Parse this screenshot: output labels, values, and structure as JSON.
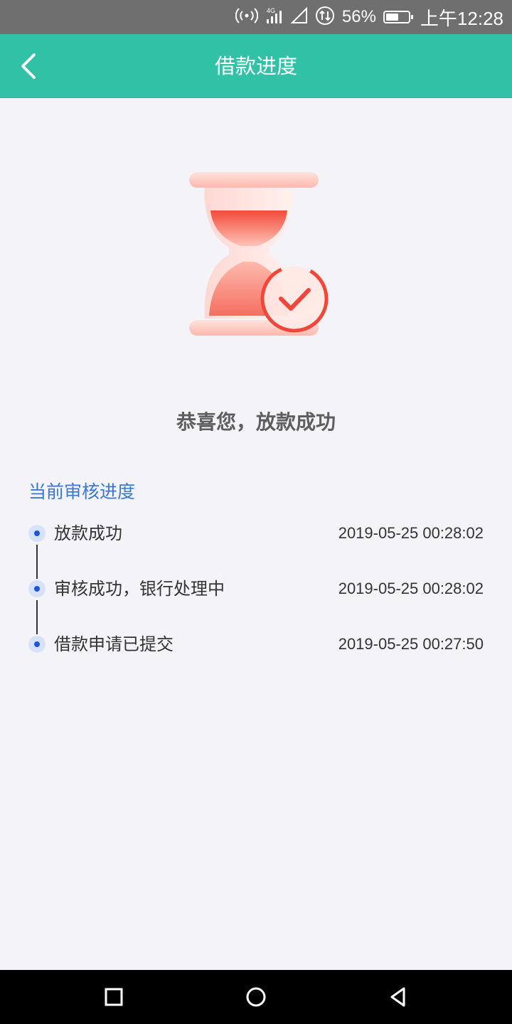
{
  "status_bar": {
    "battery_percent": "56%",
    "battery_level": 0.56,
    "clock": "上午12:28",
    "icons": [
      "hotspot-icon",
      "signal-4g-icon",
      "signal-empty-icon",
      "data-icon",
      "battery-icon"
    ]
  },
  "header": {
    "title": "借款进度",
    "back_icon": "chevron-left-icon",
    "background": "#30c1a6"
  },
  "hero": {
    "icon": "hourglass-check-illustration",
    "message": "恭喜您，放款成功"
  },
  "progress": {
    "heading": "当前审核进度",
    "heading_color": "#3c78d2",
    "steps": [
      {
        "label": "放款成功",
        "time": "2019-05-25 00:28:02"
      },
      {
        "label": "审核成功，银行处理中",
        "time": "2019-05-25 00:28:02"
      },
      {
        "label": "借款申请已提交",
        "time": "2019-05-25 00:27:50"
      }
    ]
  },
  "nav_bar": {
    "buttons": [
      "recent-apps-icon",
      "home-icon",
      "back-icon"
    ]
  }
}
